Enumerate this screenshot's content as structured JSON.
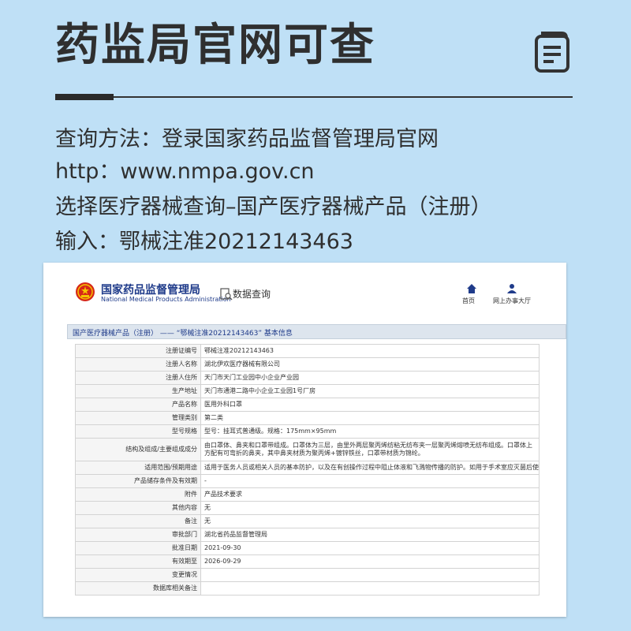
{
  "headline": "药监局官网可查",
  "instructions": {
    "line1": "查询方法：登录国家药品监督管理局官网",
    "line2": "http：www.nmpa.gov.cn",
    "line3": "选择医疗器械查询–国产医疗器械产品（注册）",
    "line4": "输入：鄂械注准20212143463"
  },
  "screenshot": {
    "site_name": "国家药品监督管理局",
    "site_name_en": "National Medical Products Administration",
    "query_label": "数据查询",
    "nav": {
      "home": "首页",
      "service_hall": "网上办事大厅"
    },
    "panel_title": "国产医疗器械产品（注册） —— “鄂械注准20212143463” 基本信息",
    "rows": [
      {
        "key": "注册证编号",
        "value": "鄂械注准20212143463"
      },
      {
        "key": "注册人名称",
        "value": "湖北伊欢医疗器械有限公司"
      },
      {
        "key": "注册人住所",
        "value": "天门市天门工业园中小企业产业园"
      },
      {
        "key": "生产地址",
        "value": "天门市通港二路中小企业工业园1号厂房"
      },
      {
        "key": "产品名称",
        "value": "医用外科口罩"
      },
      {
        "key": "管理类别",
        "value": "第二类"
      },
      {
        "key": "型号规格",
        "value": "型号：挂耳式普通级。规格：175mm×95mm"
      },
      {
        "key": "结构及组成/主要组成成分",
        "value": "由口罩体、鼻夹和口罩带组成。口罩体为三层，由里外两层聚丙烯纺粘无纺布夹一层聚丙烯熔喷无纺布组成。口罩体上方配有可弯折的鼻夹，其中鼻夹材质为聚丙烯+镀锌铁丝，口罩带材质为锦纶。"
      },
      {
        "key": "适用范围/预期用途",
        "value": "适用于医务人员或相关人员的基本防护，以及在有创操作过程中阻止体液和飞溅物传播的防护。如用于手术室应灭菌后使用。"
      },
      {
        "key": "产品储存条件及有效期",
        "value": "-"
      },
      {
        "key": "附件",
        "value": "产品技术要求"
      },
      {
        "key": "其他内容",
        "value": "无"
      },
      {
        "key": "备注",
        "value": "无"
      },
      {
        "key": "审批部门",
        "value": "湖北省药品监督管理局"
      },
      {
        "key": "批准日期",
        "value": "2021-09-30"
      },
      {
        "key": "有效期至",
        "value": "2026-09-29"
      },
      {
        "key": "变更情况",
        "value": ""
      },
      {
        "key": "数据库相关备注",
        "value": ""
      }
    ]
  },
  "colors": {
    "background": "#bfe0f6",
    "site_blue": "#1f3b8a",
    "emblem_red": "#d62718",
    "emblem_gold": "#f5c400",
    "headline": "#2f2f2f"
  },
  "icons": {
    "document": "document-list-icon",
    "emblem": "national-emblem-icon",
    "query": "search-document-icon",
    "home": "home-icon",
    "user": "user-icon"
  }
}
